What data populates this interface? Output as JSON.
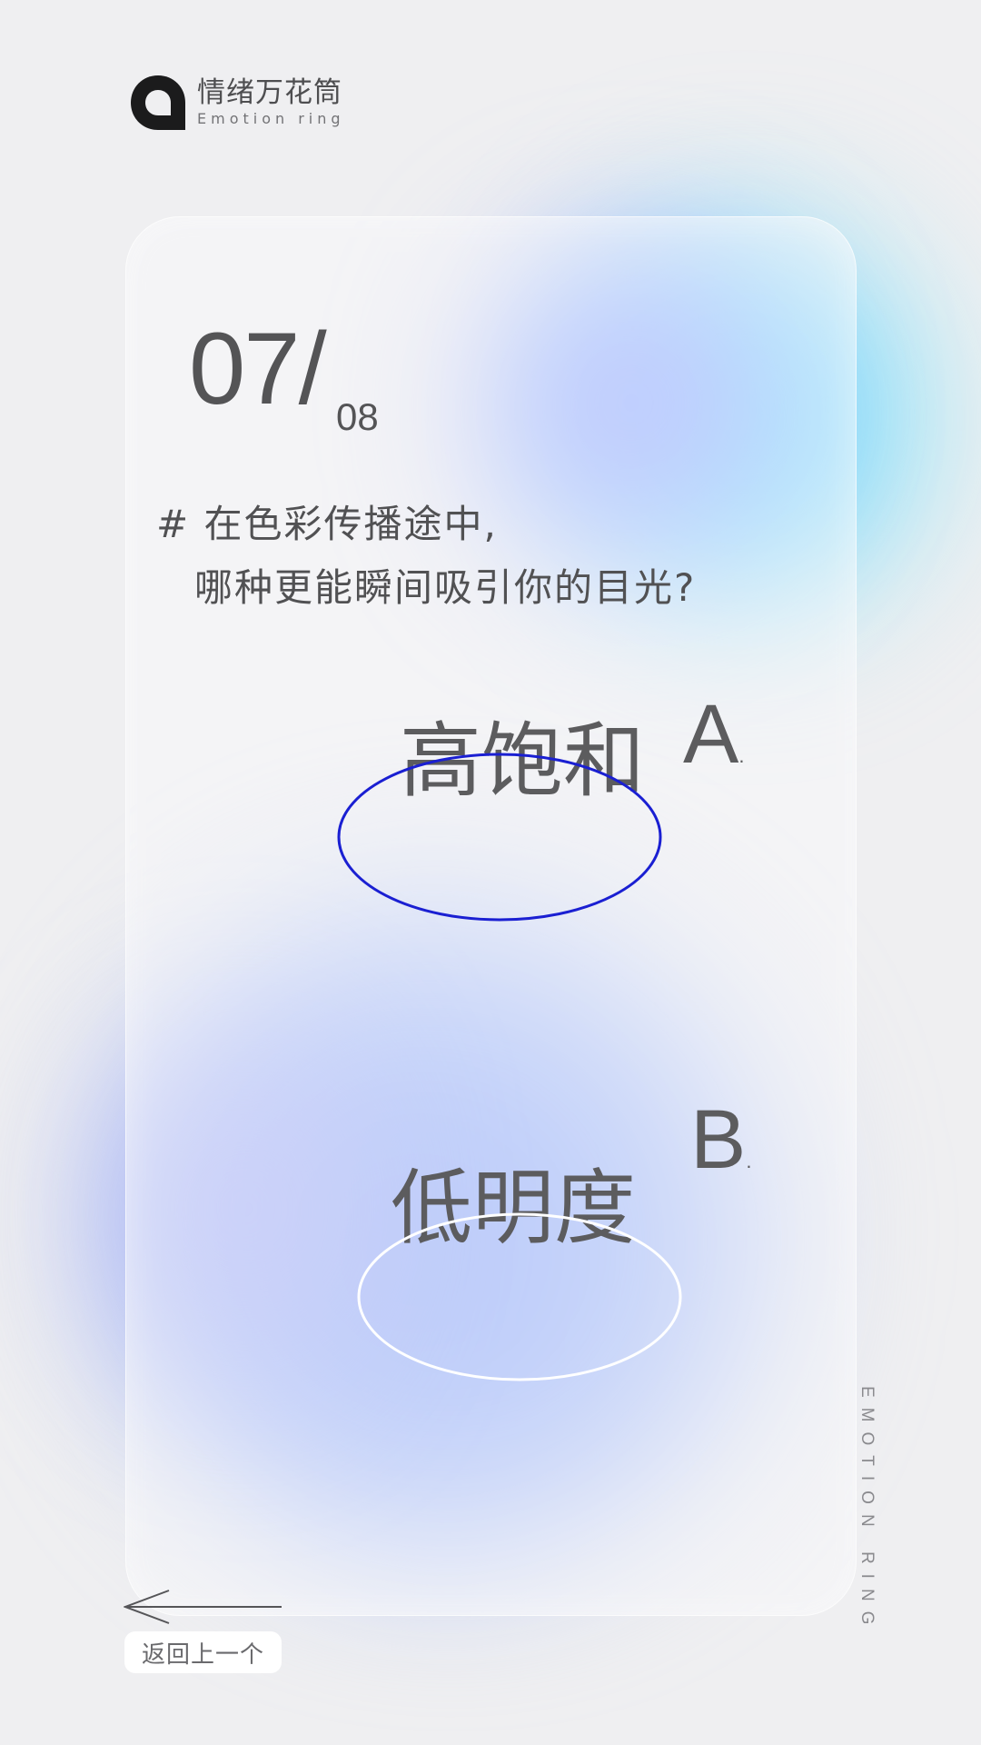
{
  "app": {
    "title": "情绪万花筒",
    "subtitle": "Emotion ring"
  },
  "progress": {
    "current": "07/",
    "total": "08"
  },
  "question": {
    "line1": "# 在色彩传播途中,",
    "line2": "哪种更能瞬间吸引你的目光?"
  },
  "options": [
    {
      "letter": "A",
      "dot": ".",
      "label": "高饱和",
      "ring_color": "#1a1fd2"
    },
    {
      "letter": "B",
      "dot": ".",
      "label": "低明度",
      "ring_color": "#ffffff"
    }
  ],
  "side_text": "EMOTION RING",
  "back": {
    "label": "返回上一个"
  },
  "colors": {
    "background": "#efeff1",
    "text": "#545456",
    "accent_cyan": "#6fd6ff",
    "accent_blue": "#8fa8f8"
  }
}
